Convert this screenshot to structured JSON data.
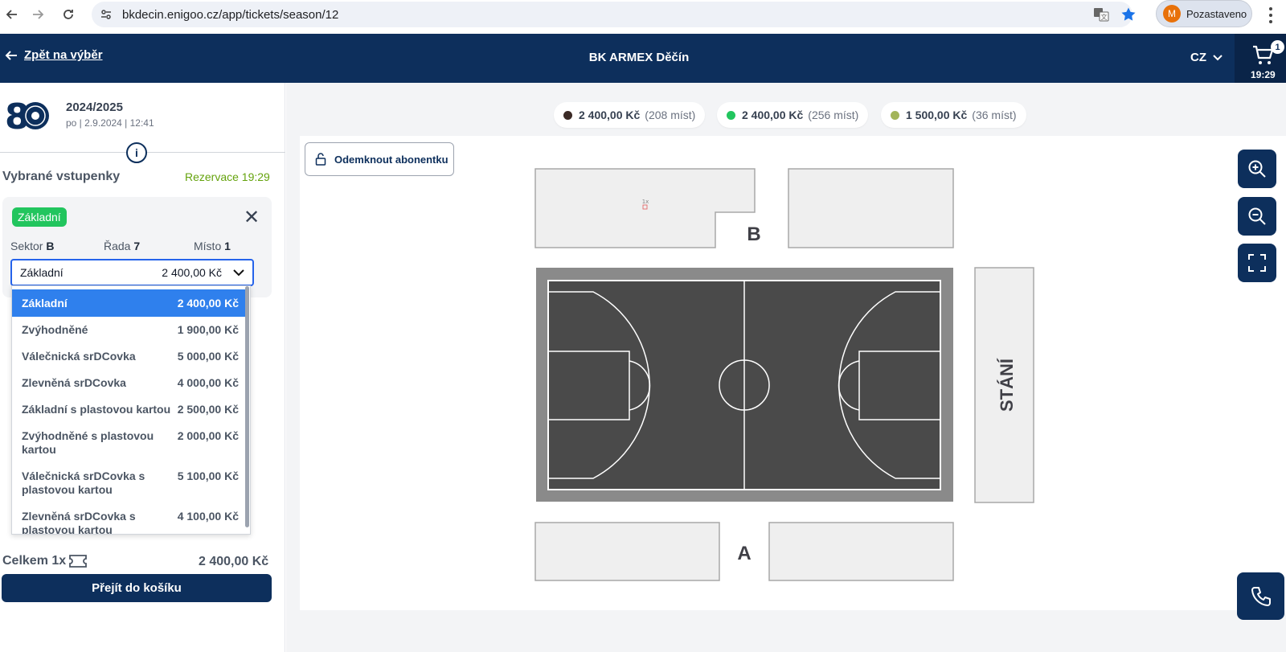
{
  "browser": {
    "url": "bkdecin.enigoo.cz/app/tickets/season/12",
    "profile_initial": "M",
    "profile_label": "Pozastaveno"
  },
  "header": {
    "back_label": "Zpět na výběr",
    "title": "BK ARMEX Děčín",
    "language": "CZ",
    "cart_count": "1",
    "cart_timer": "19:29"
  },
  "season": {
    "name": "2024/2025",
    "date": "po | 2.9.2024 | 12:41"
  },
  "selection": {
    "title": "Vybrané vstupenky",
    "reservation": "Rezervace 19:29",
    "badge": "Základní",
    "sector_label": "Sektor",
    "sector_value": "B",
    "row_label": "Řada",
    "row_value": "7",
    "seat_label": "Místo",
    "seat_value": "1",
    "selected_name": "Základní",
    "selected_price": "2 400,00 Kč",
    "options": [
      {
        "name": "Základní",
        "price": "2 400,00 Kč"
      },
      {
        "name": "Zvýhodněné",
        "price": "1 900,00 Kč"
      },
      {
        "name": "Válečnická srDCovka",
        "price": "5 000,00 Kč"
      },
      {
        "name": "Zlevněná srDCovka",
        "price": "4 000,00 Kč"
      },
      {
        "name": "Základní s plastovou kartou",
        "price": "2 500,00 Kč"
      },
      {
        "name": "Zvýhodněné s plastovou kartou",
        "price": "2 000,00 Kč"
      },
      {
        "name": "Válečnická srDCovka s plastovou kartou",
        "price": "5 100,00 Kč"
      },
      {
        "name": "Zlevněná srDCovka s plastovou kartou",
        "price": "4 100,00 Kč"
      }
    ],
    "total_label": "Celkem 1x",
    "total_price": "2 400,00 Kč",
    "checkout_label": "Přejít do košíku"
  },
  "legend": [
    {
      "price": "2 400,00 Kč",
      "count": "(208 míst)",
      "color": "#3b2a26"
    },
    {
      "price": "2 400,00 Kč",
      "count": "(256 míst)",
      "color": "#22c55e"
    },
    {
      "price": "1 500,00 Kč",
      "count": "(36 míst)",
      "color": "#a3b55a"
    }
  ],
  "map": {
    "unlock_label": "Odemknout abonentku",
    "sector_b": "B",
    "sector_a": "A",
    "standing": "STÁNÍ",
    "seat_marker": "1x",
    "court_color": "#4a4a4a",
    "court_border": "#8a8a8a"
  }
}
